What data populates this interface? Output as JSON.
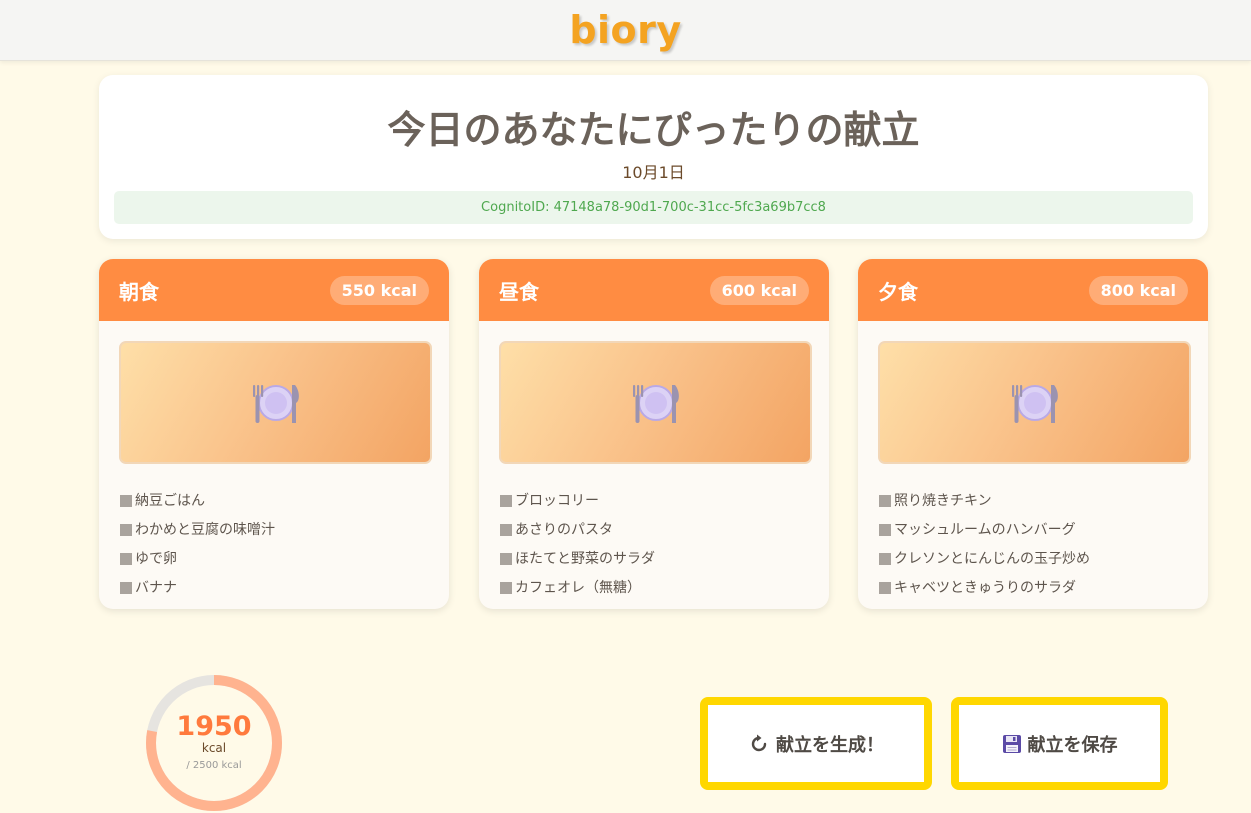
{
  "app": {
    "logo": "biory"
  },
  "header": {
    "title": "今日のあなたにぴったりの献立",
    "date": "10月1日",
    "cognito": "CognitoID: 47148a78-90d1-700c-31cc-5fc3a69b7cc8"
  },
  "meals": [
    {
      "name": "朝食",
      "kcal": "550 kcal",
      "icon": "plate-icon",
      "dishes": [
        "納豆ごはん",
        "わかめと豆腐の味噌汁",
        "ゆで卵",
        "バナナ"
      ]
    },
    {
      "name": "昼食",
      "kcal": "600 kcal",
      "icon": "plate-icon",
      "dishes": [
        "ブロッコリー",
        "あさりのパスタ",
        "ほたてと野菜のサラダ",
        "カフェオレ（無糖）"
      ]
    },
    {
      "name": "夕食",
      "kcal": "800 kcal",
      "icon": "plate-icon",
      "dishes": [
        "照り焼きチキン",
        "マッシュルームのハンバーグ",
        "クレソンとにんじんの玉子炒め",
        "キャベツときゅうりのサラダ"
      ]
    }
  ],
  "summary": {
    "total": "1950",
    "unit": "kcal",
    "goal": "/ 2500 kcal",
    "progress": 0.78
  },
  "actions": {
    "generate_label": "献立を生成！",
    "generate_icon": "refresh-icon",
    "save_label": "献立を保存",
    "save_icon": "floppy-disk-icon"
  },
  "colors": {
    "accent": "#ff8c42",
    "logo": "#f4a321",
    "button_border": "#ffd700",
    "background": "#fffae8"
  }
}
